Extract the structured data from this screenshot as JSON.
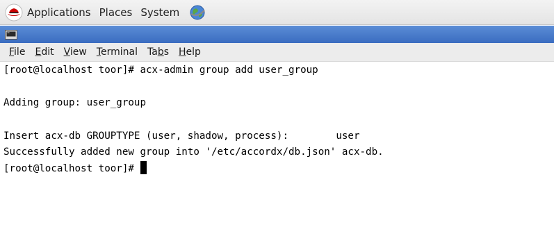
{
  "panel": {
    "menus": [
      "Applications",
      "Places",
      "System"
    ],
    "icons": {
      "applications": "redhat-icon",
      "web": "globe-icon"
    }
  },
  "window": {
    "icon": "terminal-icon",
    "title_bar_color": "#3f71c4"
  },
  "menubar": {
    "items": [
      {
        "label": "File",
        "mnemonic": "F",
        "rest": "ile"
      },
      {
        "label": "Edit",
        "mnemonic": "E",
        "rest": "dit"
      },
      {
        "label": "View",
        "mnemonic": "V",
        "rest": "iew"
      },
      {
        "label": "Terminal",
        "mnemonic": "T",
        "rest": "erminal"
      },
      {
        "label": "Tabs",
        "pre": "Ta",
        "mnemonic": "b",
        "rest": "s"
      },
      {
        "label": "Help",
        "mnemonic": "H",
        "rest": "elp"
      }
    ]
  },
  "terminal": {
    "lines": [
      "[root@localhost toor]# acx-admin group add user_group",
      "",
      "Adding group: user_group",
      "",
      "Insert acx-db GROUPTYPE (user, shadow, process):        user",
      "Successfully added new group into '/etc/accordx/db.json' acx-db.",
      "[root@localhost toor]# "
    ]
  }
}
